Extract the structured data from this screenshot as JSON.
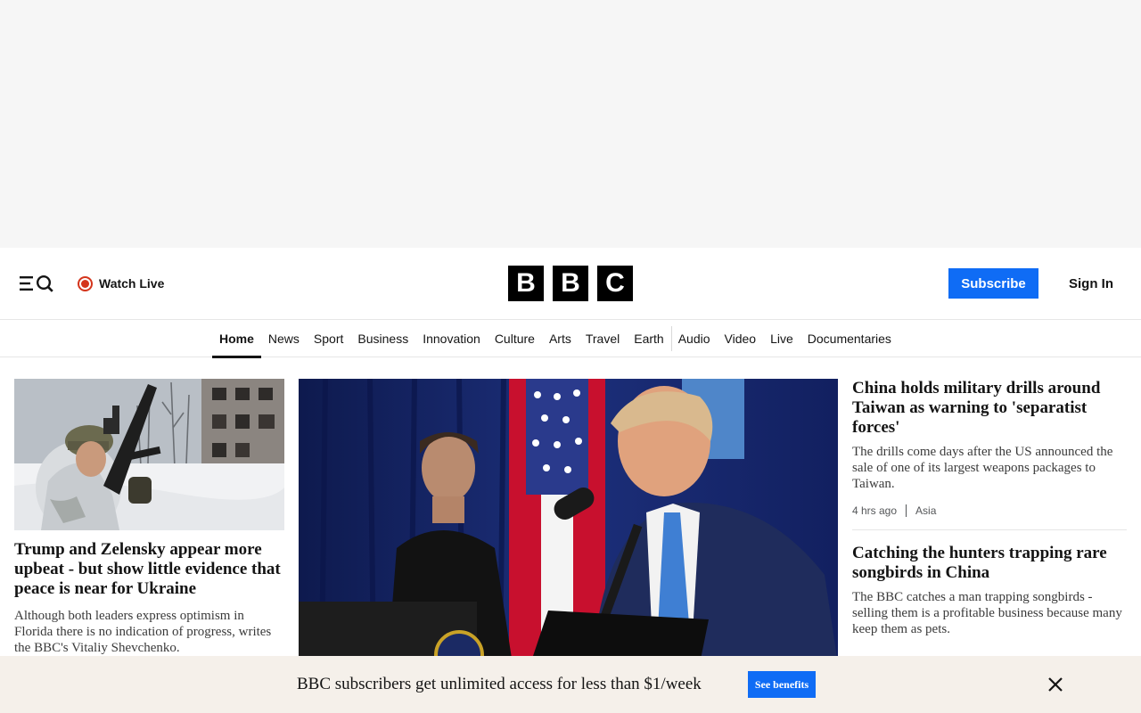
{
  "header": {
    "menu_icon": "menu-search-icon",
    "watch_live_label": "Watch Live",
    "logo_letters": [
      "B",
      "B",
      "C"
    ],
    "subscribe_label": "Subscribe",
    "sign_in_label": "Sign In"
  },
  "nav": {
    "items": [
      {
        "label": "Home",
        "active": true
      },
      {
        "label": "News"
      },
      {
        "label": "Sport"
      },
      {
        "label": "Business"
      },
      {
        "label": "Innovation"
      },
      {
        "label": "Culture"
      },
      {
        "label": "Arts"
      },
      {
        "label": "Travel"
      },
      {
        "label": "Earth"
      },
      {
        "label": "Audio"
      },
      {
        "label": "Video"
      },
      {
        "label": "Live"
      },
      {
        "label": "Documentaries"
      }
    ]
  },
  "stories": {
    "left": {
      "headline": "Trump and Zelensky appear more upbeat - but show little evidence that peace is near for Ukraine",
      "summary": "Although both leaders express optimism in Florida there is no indication of progress, writes the BBC's Vitaliy Shevchenko."
    },
    "right": [
      {
        "headline": "China holds military drills around Taiwan as warning to 'separatist forces'",
        "summary": "The drills come days after the US announced the sale of one of its largest weapons packages to Taiwan.",
        "time": "4 hrs ago",
        "tag": "Asia"
      },
      {
        "headline": "Catching the hunters trapping rare songbirds in China",
        "summary": "The BBC catches a man trapping songbirds - selling them is a profitable business because many keep them as pets."
      }
    ]
  },
  "banner": {
    "text": "BBC subscribers get unlimited access for less than $1/week",
    "button_label": "See benefits"
  },
  "colors": {
    "accent": "#0f6cf5",
    "live_red": "#d4351c",
    "ad_bg": "#f6f6f6",
    "banner_bg": "#f5f0ea"
  }
}
